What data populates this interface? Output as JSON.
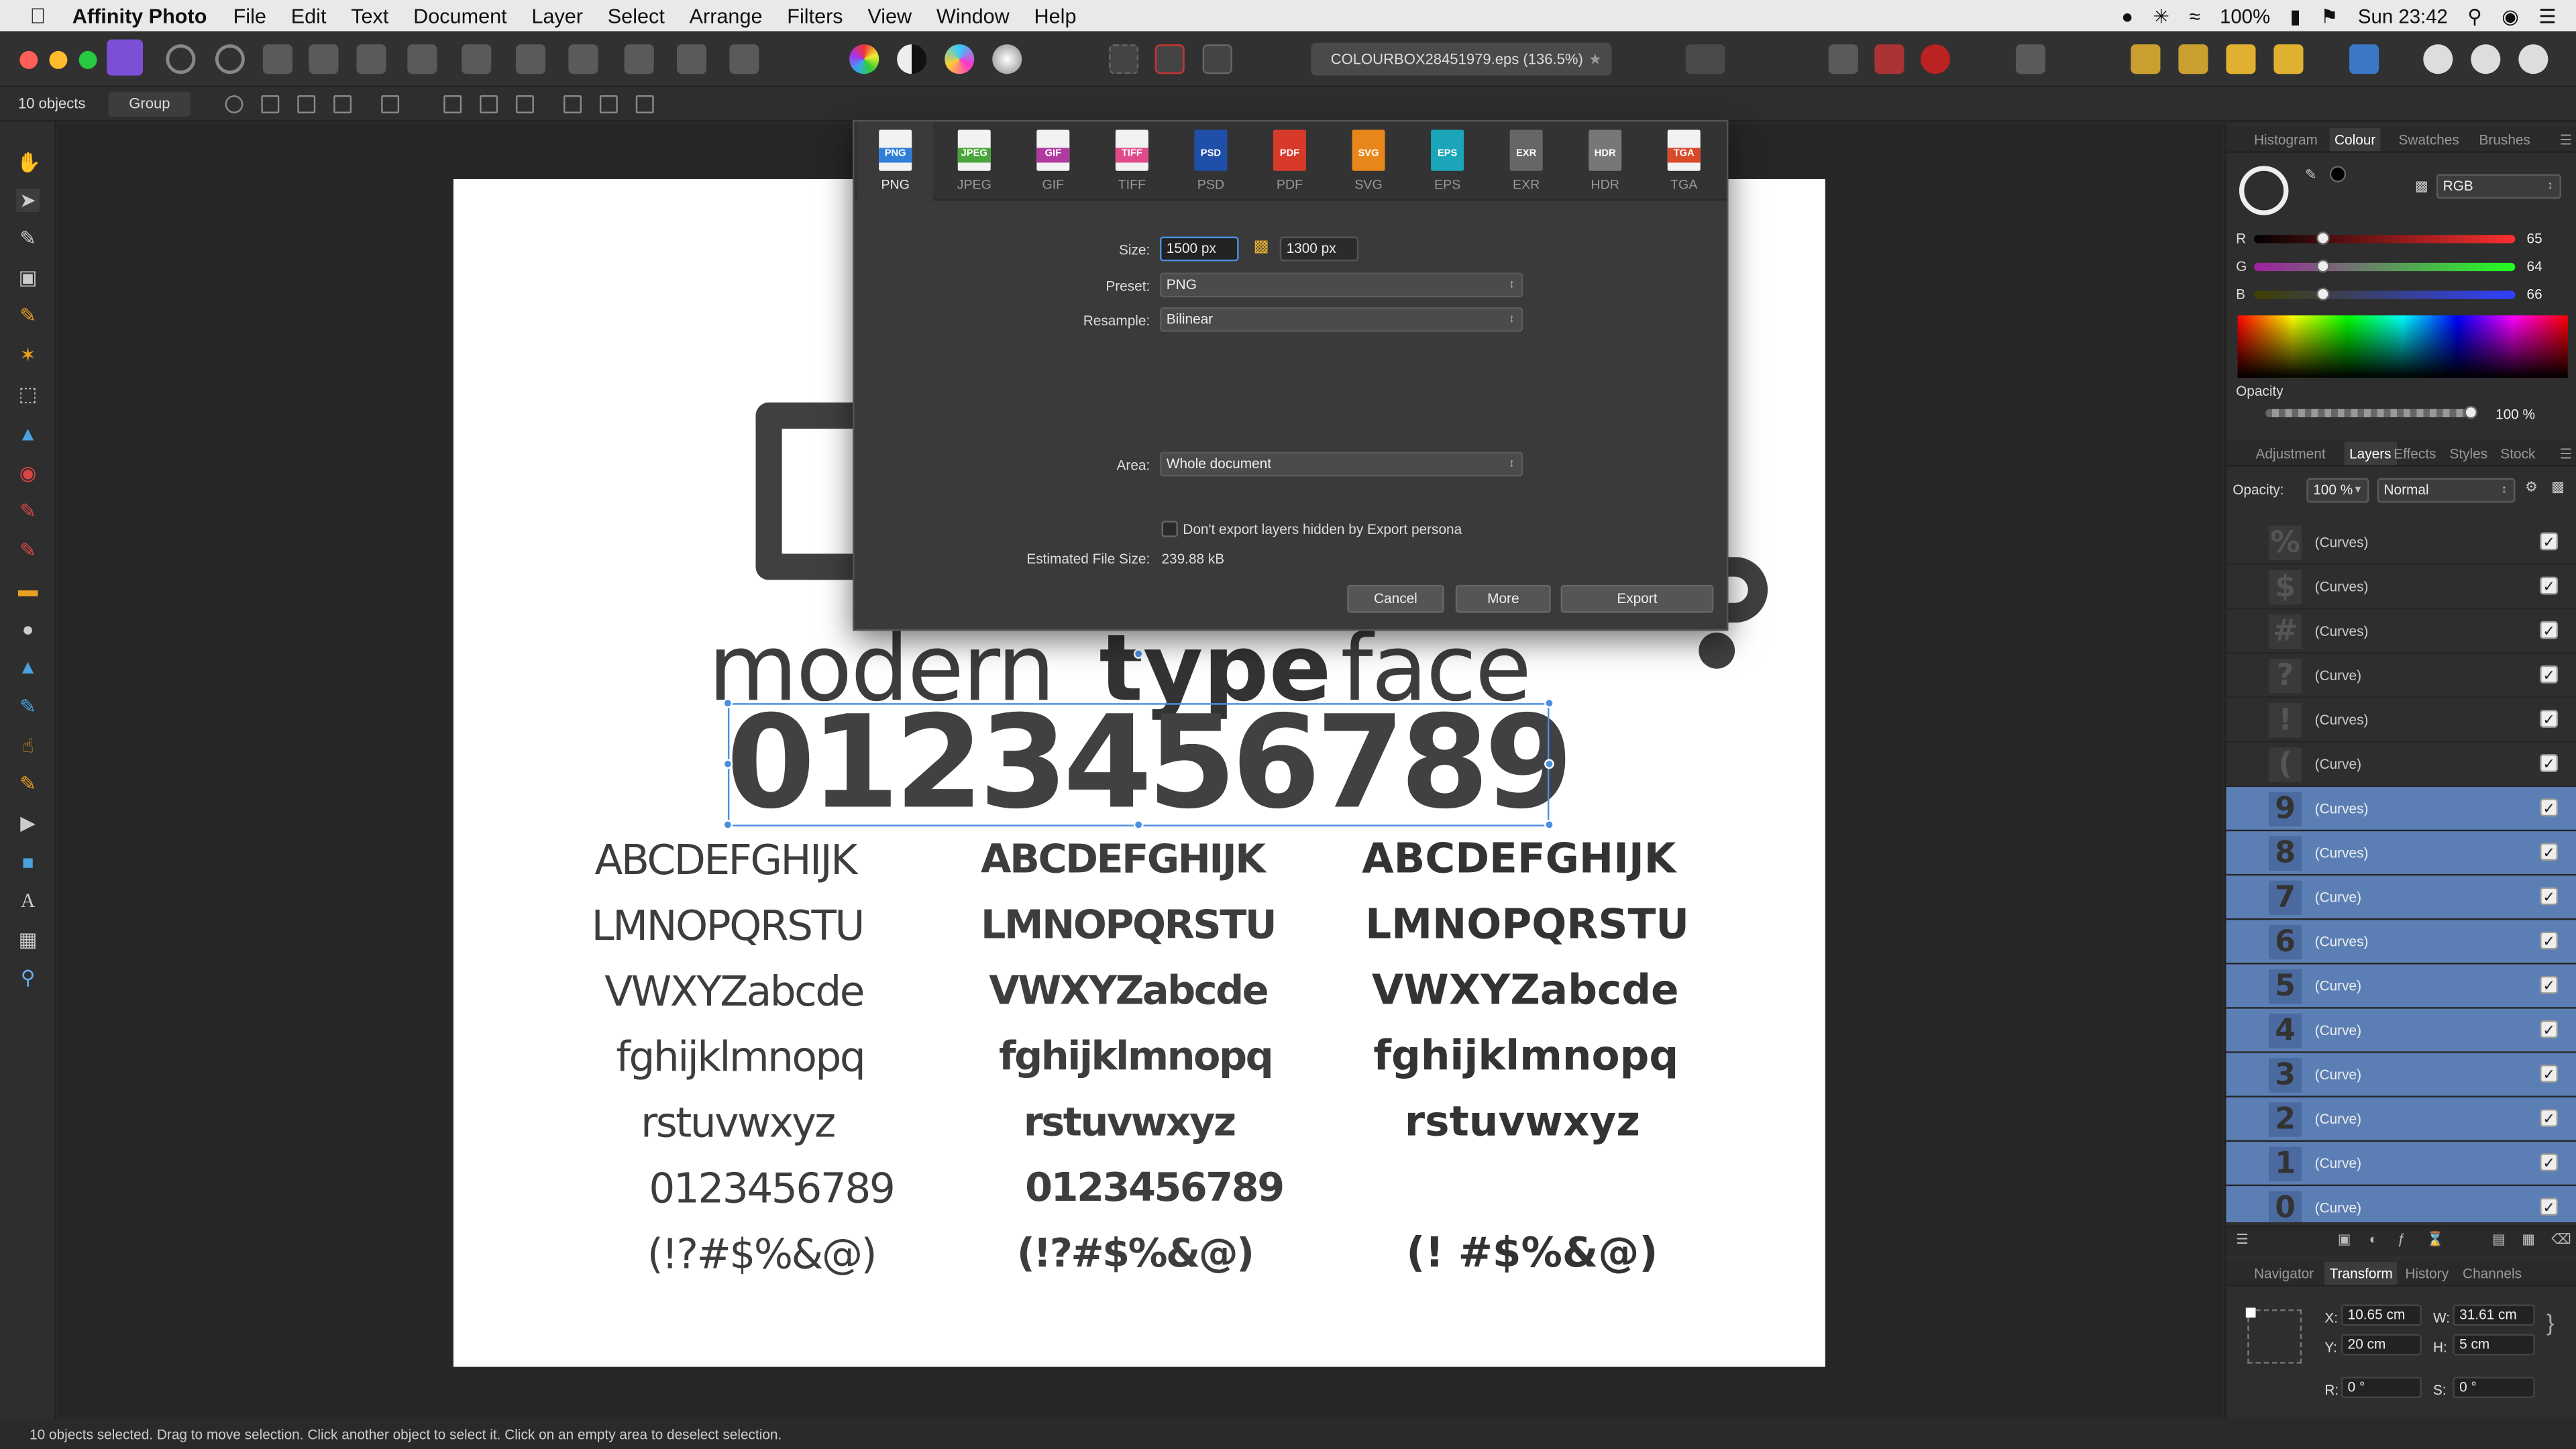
{
  "menubar": {
    "app_name": "Affinity Photo",
    "items": [
      "File",
      "Edit",
      "Text",
      "Document",
      "Layer",
      "Select",
      "Arrange",
      "Filters",
      "View",
      "Window",
      "Help"
    ],
    "battery": "100%",
    "clock": "Sun 23:42"
  },
  "toolbar": {
    "document_title": "COLOURBOX28451979.eps (136.5%)"
  },
  "context": {
    "selection_count": "10 objects",
    "group_label": "Group"
  },
  "document": {
    "line_modern": "modern",
    "line_type": "type",
    "line_face": "face",
    "digits_big": "0123456789",
    "thin_rows": [
      "ABCDEFGHIJK",
      "LMNOPQRSTU",
      "VWXYZabcde",
      "fghijklmnopq",
      "rstuvwxyz",
      "0123456789",
      "(!?#$%&@)"
    ],
    "medium_rows": [
      "ABCDEFGHIJK",
      "LMNOPQRSTU",
      "VWXYZabcde",
      "fghijklmnopq",
      "rstuvwxyz",
      "0123456789",
      "(!?#$%&@)"
    ],
    "bold_rows": [
      "ABCDEFGHIJK",
      "LMNOPQRSTU",
      "VWXYZabcde",
      "fghijklmnopq",
      "rstuvwxyz",
      "(!  #$%&@)"
    ]
  },
  "export_dialog": {
    "formats": [
      "PNG",
      "JPEG",
      "GIF",
      "TIFF",
      "PSD",
      "PDF",
      "SVG",
      "EPS",
      "EXR",
      "HDR",
      "TGA"
    ],
    "active_format": "PNG",
    "size_label": "Size:",
    "width_value": "1500 px",
    "height_value": "1300 px",
    "preset_label": "Preset:",
    "preset_value": "PNG",
    "resample_label": "Resample:",
    "resample_value": "Bilinear",
    "area_label": "Area:",
    "area_value": "Whole document",
    "hidden_layers_label": "Don't export layers hidden by Export persona",
    "file_size_label": "Estimated File Size:",
    "file_size_value": "239.88 kB",
    "cancel_label": "Cancel",
    "more_label": "More",
    "export_label": "Export"
  },
  "colour_panel": {
    "tabs": [
      "Histogram",
      "Colour",
      "Swatches",
      "Brushes"
    ],
    "active_tab": "Colour",
    "model": "RGB",
    "r_label": "R",
    "r_value": "65",
    "g_label": "G",
    "g_value": "64",
    "b_label": "B",
    "b_value": "66",
    "opacity_label": "Opacity",
    "opacity_value": "100 %"
  },
  "layers_panel": {
    "tabs": [
      "Adjustment",
      "Layers",
      "Effects",
      "Styles",
      "Stock"
    ],
    "active_tab": "Layers",
    "opacity_label": "Opacity:",
    "opacity_value": "100 %",
    "blend_mode": "Normal",
    "rows": [
      {
        "glyph": "%",
        "name": "(Curves)",
        "selected": false
      },
      {
        "glyph": "$",
        "name": "(Curves)",
        "selected": false
      },
      {
        "glyph": "#",
        "name": "(Curves)",
        "selected": false
      },
      {
        "glyph": "?",
        "name": "(Curve)",
        "selected": false
      },
      {
        "glyph": "!",
        "name": "(Curves)",
        "selected": false
      },
      {
        "glyph": "(",
        "name": "(Curve)",
        "selected": false
      },
      {
        "glyph": "9",
        "name": "(Curves)",
        "selected": true
      },
      {
        "glyph": "8",
        "name": "(Curves)",
        "selected": true
      },
      {
        "glyph": "7",
        "name": "(Curve)",
        "selected": true
      },
      {
        "glyph": "6",
        "name": "(Curves)",
        "selected": true
      },
      {
        "glyph": "5",
        "name": "(Curve)",
        "selected": true
      },
      {
        "glyph": "4",
        "name": "(Curve)",
        "selected": true
      },
      {
        "glyph": "3",
        "name": "(Curve)",
        "selected": true
      },
      {
        "glyph": "2",
        "name": "(Curve)",
        "selected": true
      },
      {
        "glyph": "1",
        "name": "(Curve)",
        "selected": true
      },
      {
        "glyph": "0",
        "name": "(Curve)",
        "selected": true
      }
    ]
  },
  "transform_panel": {
    "tabs": [
      "Navigator",
      "Transform",
      "History",
      "Channels"
    ],
    "active_tab": "Transform",
    "x_label": "X:",
    "x_value": "10.65 cm",
    "y_label": "Y:",
    "y_value": "20 cm",
    "w_label": "W:",
    "w_value": "31.61 cm",
    "h_label": "H:",
    "h_value": "5 cm",
    "r_label": "R:",
    "r_value": "0 °",
    "s_label": "S:",
    "s_value": "0 °"
  },
  "status": {
    "text": "10 objects selected. Drag to move selection. Click another object to select it. Click on an empty area to deselect selection."
  },
  "colors": {
    "accent_blue": "#4a8fe0",
    "selected_layer": "#5b7fb5",
    "swatch_fill": "#414042"
  }
}
